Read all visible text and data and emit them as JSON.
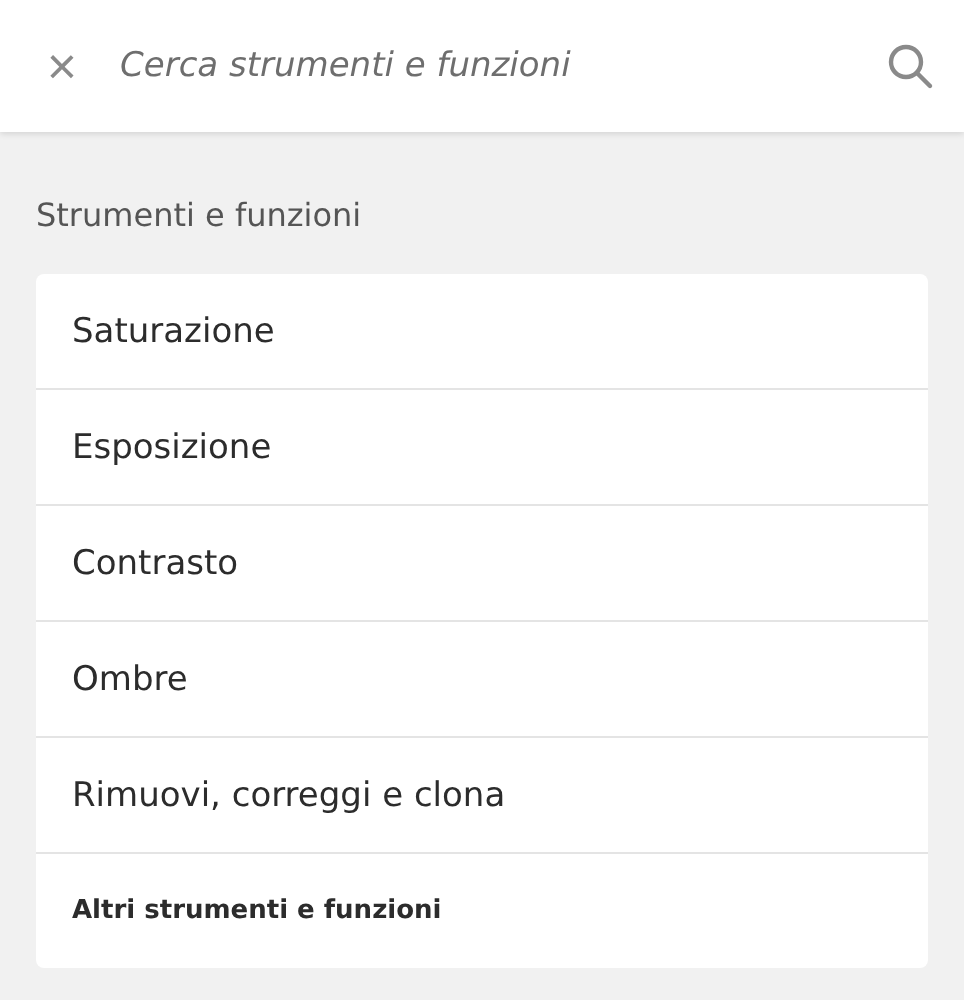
{
  "search_bar": {
    "close": "×",
    "placeholder": "Cerca strumenti e funzioni"
  },
  "section": {
    "title": "Strumenti e funzioni",
    "items": [
      {
        "label": "Saturazione",
        "kind": "tool"
      },
      {
        "label": "Esposizione",
        "kind": "tool"
      },
      {
        "label": "Contrasto",
        "kind": "tool"
      },
      {
        "label": "Ombre",
        "kind": "tool"
      },
      {
        "label": "Rimuovi, correggi e clona",
        "kind": "tool"
      },
      {
        "label": "Altri strumenti e funzioni",
        "kind": "more"
      }
    ]
  }
}
